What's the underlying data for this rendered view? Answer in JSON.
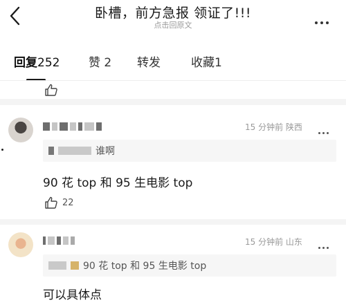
{
  "header": {
    "title": "卧槽，前方急报 领证了!!!",
    "subtitle": "点击回原文"
  },
  "tabs": [
    {
      "label": "回复",
      "count": "252",
      "active": true
    },
    {
      "label": "赞",
      "count": "2",
      "active": false
    },
    {
      "label": "转发",
      "count": "",
      "active": false
    },
    {
      "label": "收藏",
      "count": "1",
      "active": false
    }
  ],
  "comments": [
    {
      "time": "15 分钟前",
      "location": "陕西",
      "quote_text": "谁啊",
      "body": "90 花 top 和 95 生电影 top",
      "likes": "22"
    },
    {
      "time": "15 分钟前",
      "location": "山东",
      "quote_text": "90 花 top 和 95 生电影 top",
      "body": "可以具体点"
    }
  ],
  "icons": {
    "back": "chevron-left-icon",
    "more": "more-dots-icon",
    "like": "thumb-up-icon"
  },
  "colors": {
    "text": "#1a1a1a",
    "muted": "#999999",
    "quote_bg": "#f6f6f6"
  }
}
